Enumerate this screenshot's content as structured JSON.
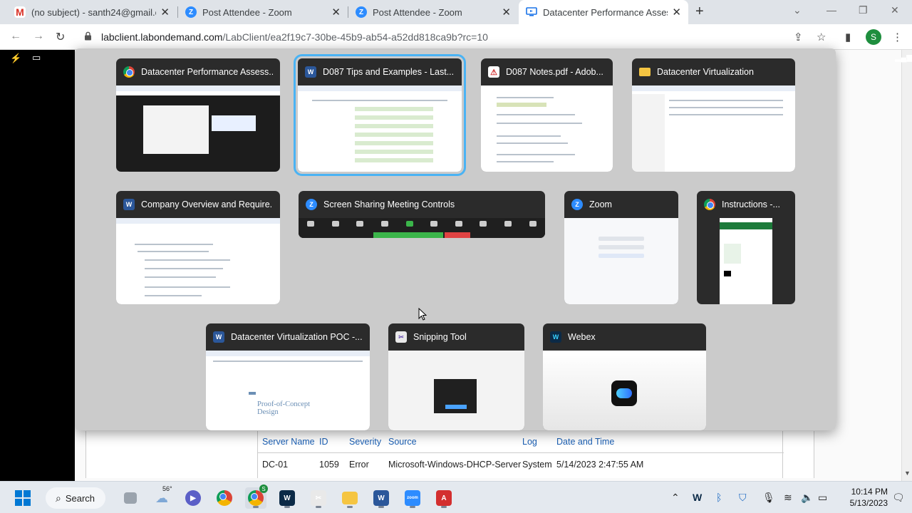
{
  "browser": {
    "tabs": [
      {
        "title": "(no subject) - santh24@gmail.co",
        "icon": "gmail-icon",
        "active": false
      },
      {
        "title": "Post Attendee - Zoom",
        "icon": "zoom-icon",
        "active": false
      },
      {
        "title": "Post Attendee - Zoom",
        "icon": "zoom-icon",
        "active": false
      },
      {
        "title": "Datacenter Performance Assessm",
        "icon": "lab-icon",
        "active": true
      }
    ],
    "url_host": "labclient.labondemand.com",
    "url_path": "/LabClient/ea2f19c7-30be-45b9-ab54-a52dd818ca9b?rc=10",
    "profile_initial": "S"
  },
  "switcher": {
    "windows": [
      {
        "title": "Datacenter Performance Assess...",
        "app": "chrome"
      },
      {
        "title": "D087 Tips and Examples  -  Last...",
        "app": "word"
      },
      {
        "title": "D087 Notes.pdf - Adob...",
        "app": "acrobat"
      },
      {
        "title": "Datacenter Virtualization",
        "app": "explorer"
      },
      {
        "title": "Company Overview and Require...",
        "app": "word"
      },
      {
        "title": "Screen Sharing Meeting Controls",
        "app": "zoom"
      },
      {
        "title": "Zoom",
        "app": "zoom"
      },
      {
        "title": "Instructions -...",
        "app": "chrome"
      },
      {
        "title": "Datacenter Virtualization POC  -...",
        "app": "word"
      },
      {
        "title": "Snipping Tool",
        "app": "snipping-tool"
      },
      {
        "title": "Webex",
        "app": "webex"
      }
    ],
    "selected_index": 1,
    "poc_thumb_text": "Proof-of-Concept\nDesign"
  },
  "event_log": {
    "headers": [
      "Server Name",
      "ID",
      "Severity",
      "Source",
      "Log",
      "Date and Time"
    ],
    "row": [
      "DC-01",
      "1059",
      "Error",
      "Microsoft-Windows-DHCP-Server",
      "System",
      "5/14/2023 2:47:55 AM"
    ]
  },
  "taskbar": {
    "search_label": "Search",
    "weather_temp": "56°",
    "chrome_badge": "S",
    "time": "10:14 PM",
    "date": "5/13/2023"
  }
}
